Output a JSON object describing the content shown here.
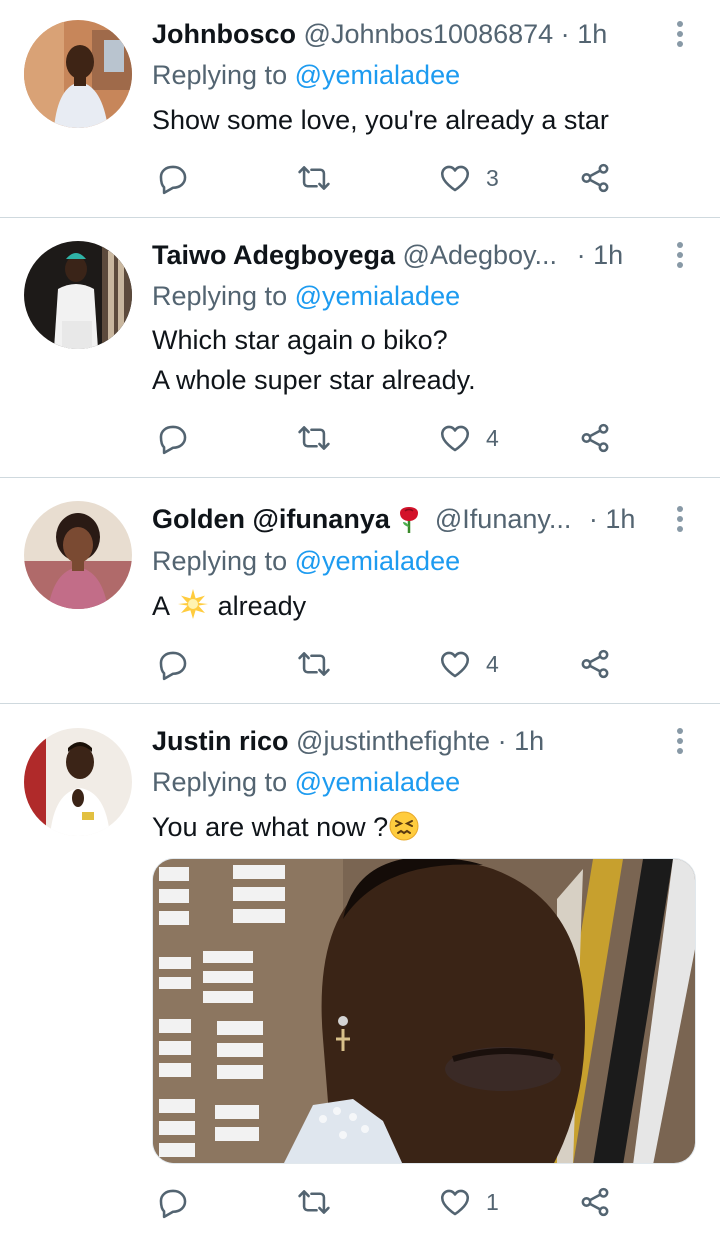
{
  "tweets": [
    {
      "name": "Johnbosco",
      "handle": "@Johnbos10086874",
      "dot": "·",
      "time": "1h",
      "replying_prefix": "Replying to",
      "replying_to": "@yemialadee",
      "lines": [
        "Show some love, you're already a star"
      ],
      "likes": "3",
      "avatar_icon": "avatar-johnbosco"
    },
    {
      "name": "Taiwo Adegboyega",
      "handle": "@Adegboy...",
      "dot": "·",
      "time": "1h",
      "replying_prefix": "Replying to",
      "replying_to": "@yemialadee",
      "lines": [
        "Which star again o biko?",
        "A whole super star already."
      ],
      "likes": "4",
      "avatar_icon": "avatar-taiwo"
    },
    {
      "name": "Golden @ifunanya",
      "name_emoji": "rose-emoji",
      "handle": "@Ifunany...",
      "dot": "·",
      "time": "1h",
      "replying_prefix": "Replying to",
      "replying_to": "@yemialadee",
      "text_before": "A",
      "text_emoji": "star-emoji",
      "text_after": "already",
      "likes": "4",
      "avatar_icon": "avatar-golden"
    },
    {
      "name": "Justin rico",
      "handle": "@justinthefighte",
      "dot": "·",
      "time": "1h",
      "replying_prefix": "Replying to",
      "replying_to": "@yemialadee",
      "text": "You are what now ?",
      "text_emoji": "persevering-face-emoji",
      "likes": "1",
      "avatar_icon": "avatar-justin",
      "media": "attached-photo"
    }
  ],
  "colors": {
    "accent": "#1d9bf0",
    "secondary_text": "#536471",
    "icon": "#536471",
    "divider": "#cfd9de"
  }
}
